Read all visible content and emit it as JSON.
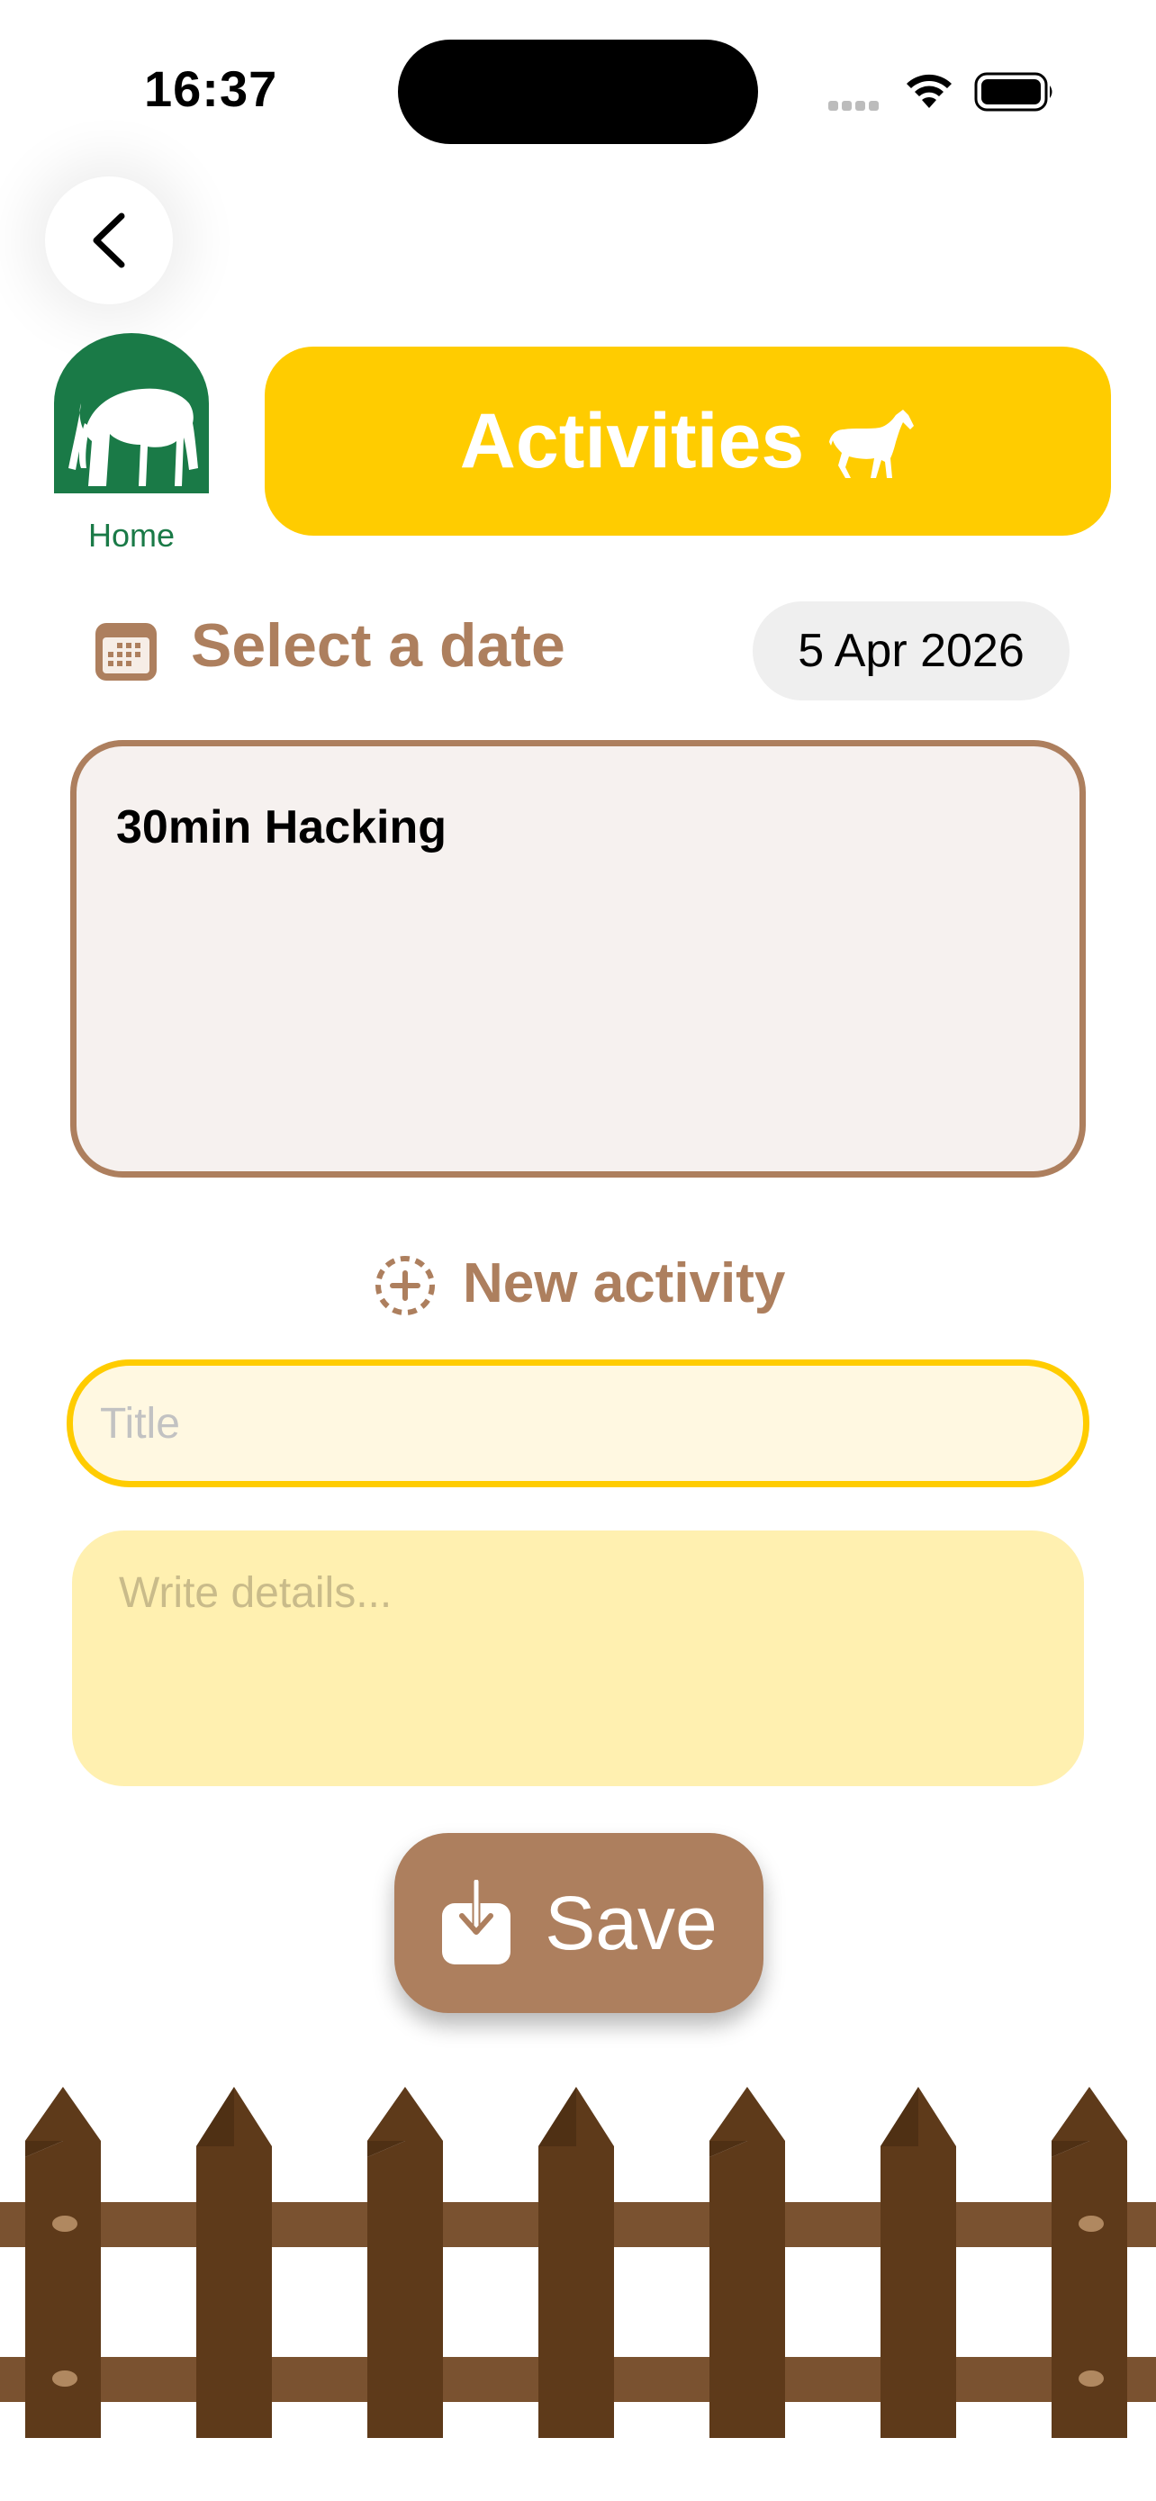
{
  "status_bar": {
    "time": "16:37"
  },
  "nav": {
    "back_icon": "chevron-left-icon",
    "home_label": "Home"
  },
  "header": {
    "title": "Activities",
    "icon": "horse-icon"
  },
  "date_picker": {
    "label": "Select a date",
    "icon": "calendar-icon",
    "value": "5 Apr 2026"
  },
  "activities": [
    {
      "title": "30min Hacking"
    }
  ],
  "new_activity": {
    "label": "New activity",
    "icon": "add-circle-icon",
    "title_placeholder": "Title",
    "title_value": "",
    "details_placeholder": "Write details...",
    "details_value": ""
  },
  "save_button": {
    "label": "Save",
    "icon": "download-icon"
  },
  "colors": {
    "accent_yellow": "#ffcc00",
    "brown": "#ad7f5e",
    "home_green": "#1a7a47",
    "fence_brown": "#5e3a1a"
  }
}
